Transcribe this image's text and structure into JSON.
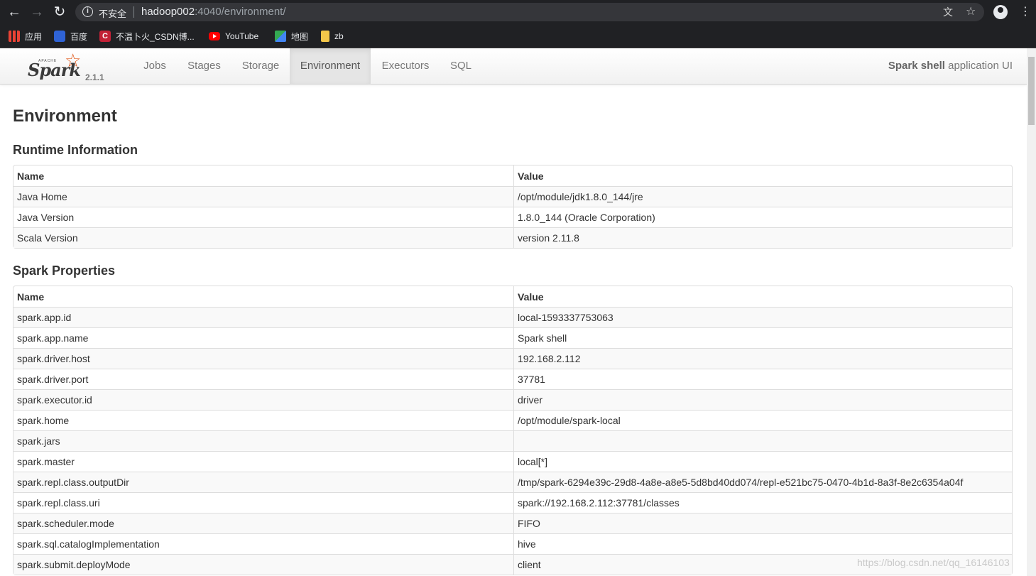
{
  "browser": {
    "security_label": "不安全",
    "url_host": "hadoop002",
    "url_rest": ":4040/environment/",
    "bookmarks": [
      {
        "label": "应用",
        "icon": "apps-grid-icon"
      },
      {
        "label": "百度",
        "icon": "baidu-icon"
      },
      {
        "label": "不温卜火_CSDN博...",
        "icon": "csdn-icon"
      },
      {
        "label": "YouTube",
        "icon": "youtube-icon"
      },
      {
        "label": "地图",
        "icon": "maps-icon"
      },
      {
        "label": "zb",
        "icon": "folder-icon"
      }
    ]
  },
  "navbar": {
    "brand_apache": "APACHE",
    "brand_spark": "Spark",
    "version": "2.1.1",
    "tabs": [
      {
        "label": "Jobs"
      },
      {
        "label": "Stages"
      },
      {
        "label": "Storage"
      },
      {
        "label": "Environment",
        "active": true
      },
      {
        "label": "Executors"
      },
      {
        "label": "SQL"
      }
    ],
    "app_name": "Spark shell",
    "app_suffix": " application UI"
  },
  "page": {
    "title": "Environment"
  },
  "runtime": {
    "heading": "Runtime Information",
    "columns": [
      "Name",
      "Value"
    ],
    "rows": [
      [
        "Java Home",
        "/opt/module/jdk1.8.0_144/jre"
      ],
      [
        "Java Version",
        "1.8.0_144 (Oracle Corporation)"
      ],
      [
        "Scala Version",
        "version 2.11.8"
      ]
    ]
  },
  "spark_props": {
    "heading": "Spark Properties",
    "columns": [
      "Name",
      "Value"
    ],
    "rows": [
      [
        "spark.app.id",
        "local-1593337753063"
      ],
      [
        "spark.app.name",
        "Spark shell"
      ],
      [
        "spark.driver.host",
        "192.168.2.112"
      ],
      [
        "spark.driver.port",
        "37781"
      ],
      [
        "spark.executor.id",
        "driver"
      ],
      [
        "spark.home",
        "/opt/module/spark-local"
      ],
      [
        "spark.jars",
        ""
      ],
      [
        "spark.master",
        "local[*]"
      ],
      [
        "spark.repl.class.outputDir",
        "/tmp/spark-6294e39c-29d8-4a8e-a8e5-5d8bd40dd074/repl-e521bc75-0470-4b1d-8a3f-8e2c6354a04f"
      ],
      [
        "spark.repl.class.uri",
        "spark://192.168.2.112:37781/classes"
      ],
      [
        "spark.scheduler.mode",
        "FIFO"
      ],
      [
        "spark.sql.catalogImplementation",
        "hive"
      ],
      [
        "spark.submit.deployMode",
        "client"
      ]
    ]
  },
  "watermark": "https://blog.csdn.net/qq_16146103",
  "colors": {
    "chrome_bg": "#202124",
    "omnibox_bg": "#35363a",
    "spark_orange": "#e25a1c",
    "table_border": "#dddddd",
    "stripe": "#f9f9f9"
  }
}
